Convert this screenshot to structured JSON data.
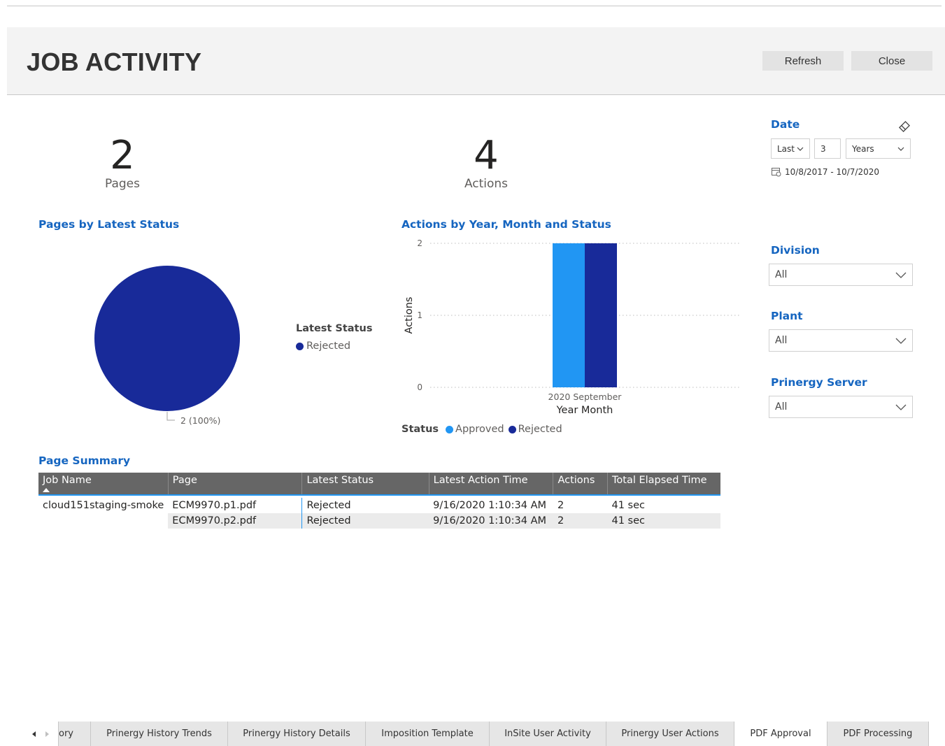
{
  "header": {
    "title": "JOB ACTIVITY",
    "refresh_label": "Refresh",
    "close_label": "Close"
  },
  "kpis": [
    {
      "value": "2",
      "label": "Pages"
    },
    {
      "value": "4",
      "label": "Actions"
    }
  ],
  "pie": {
    "title": "Pages by Latest Status",
    "legend_title": "Latest Status",
    "legend_item": "Rejected",
    "slice_label": "2 (100%)",
    "color": "#182a99"
  },
  "bar": {
    "title": "Actions by Year, Month and Status",
    "legend_title": "Status",
    "colors": {
      "approved": "#2196f3",
      "rejected": "#182a99"
    }
  },
  "chart_data": [
    {
      "type": "pie",
      "title": "Pages by Latest Status",
      "legend_title": "Latest Status",
      "slices": [
        {
          "name": "Rejected",
          "value": 2,
          "label": "2 (100%)"
        }
      ]
    },
    {
      "type": "bar",
      "title": "Actions by Year, Month and Status",
      "xlabel": "Year Month",
      "ylabel": "Actions",
      "categories": [
        "2020 September"
      ],
      "yticks": [
        "0",
        "1",
        "2"
      ],
      "ylim": [
        0,
        2
      ],
      "legend_title": "Status",
      "series": [
        {
          "name": "Approved",
          "values": [
            2
          ]
        },
        {
          "name": "Rejected",
          "values": [
            2
          ]
        }
      ]
    }
  ],
  "slicers": {
    "date": {
      "title": "Date",
      "mode": "Last",
      "count": "3",
      "unit": "Years",
      "range": "10/8/2017 - 10/7/2020"
    },
    "division": {
      "title": "Division",
      "value": "All"
    },
    "plant": {
      "title": "Plant",
      "value": "All"
    },
    "server": {
      "title": "Prinergy Server",
      "value": "All"
    }
  },
  "summary": {
    "title": "Page Summary",
    "columns": [
      "Job Name",
      "Page",
      "Latest Status",
      "Latest Action Time",
      "Actions",
      "Total Elapsed Time"
    ],
    "rows": [
      [
        "cloud151staging-smoke",
        "ECM9970.p1.pdf",
        "Rejected",
        "9/16/2020 1:10:34 AM",
        "2",
        "41 sec"
      ],
      [
        "",
        "ECM9970.p2.pdf",
        "Rejected",
        "9/16/2020 1:10:34 AM",
        "2",
        "41 sec"
      ]
    ]
  },
  "tabs": [
    "ory",
    "Prinergy History Trends",
    "Prinergy History Details",
    "Imposition Template",
    "InSite User Activity",
    "Prinergy User Actions",
    "PDF Approval",
    "PDF Processing"
  ],
  "active_tab": "PDF Approval"
}
